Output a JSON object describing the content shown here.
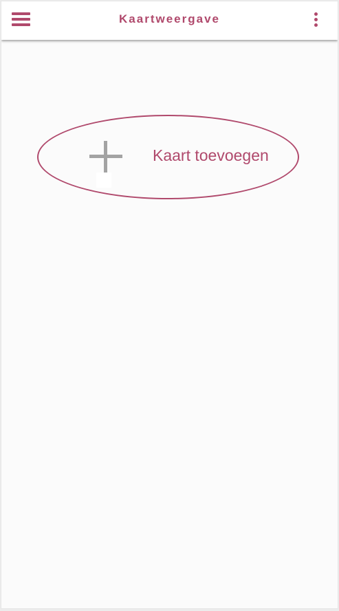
{
  "colors": {
    "accent": "#b0496c",
    "icon_gray": "#a3a3a3",
    "background": "#fbfbfb",
    "appbar": "#ffffff"
  },
  "appbar": {
    "title": "Kaartweergave",
    "menu_icon": "hamburger-menu-icon",
    "more_icon": "more-vertical-icon"
  },
  "main": {
    "add_card": {
      "icon": "plus-icon",
      "label": "Kaart toevoegen"
    }
  }
}
